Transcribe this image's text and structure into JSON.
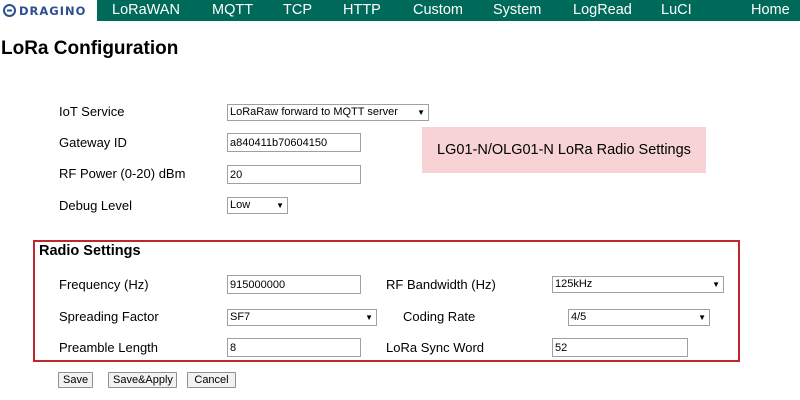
{
  "nav": {
    "logo_text": "DRAGINO",
    "items": [
      "LoRaWAN",
      "MQTT",
      "TCP",
      "HTTP",
      "Custom",
      "System",
      "LogRead",
      "LuCI",
      "Home"
    ]
  },
  "page": {
    "title": "LoRa Configuration"
  },
  "general": {
    "iot_service_label": "IoT Service",
    "iot_service_value": "LoRaRaw forward to MQTT server",
    "gateway_id_label": "Gateway ID",
    "gateway_id_value": "a840411b70604150",
    "rf_power_label": "RF Power (0-20) dBm",
    "rf_power_value": "20",
    "debug_level_label": "Debug Level",
    "debug_level_value": "Low"
  },
  "note": {
    "text": "LG01-N/OLG01-N LoRa Radio Settings"
  },
  "radio": {
    "title": "Radio Settings",
    "frequency_label": "Frequency (Hz)",
    "frequency_value": "915000000",
    "bandwidth_label": "RF Bandwidth (Hz)",
    "bandwidth_value": "125kHz",
    "spreading_factor_label": "Spreading Factor",
    "spreading_factor_value": "SF7",
    "coding_rate_label": "Coding Rate",
    "coding_rate_value": "4/5",
    "preamble_label": "Preamble Length",
    "preamble_value": "8",
    "sync_word_label": "LoRa Sync Word",
    "sync_word_value": "52"
  },
  "buttons": {
    "save": "Save",
    "save_apply": "Save&Apply",
    "cancel": "Cancel"
  },
  "colors": {
    "nav_background": "#006a5a",
    "radio_border": "#c0262b",
    "note_background": "#f7d3d5"
  },
  "icons": {
    "logo": "dragino-logo-icon",
    "dropdown": "triangle-down-icon"
  }
}
